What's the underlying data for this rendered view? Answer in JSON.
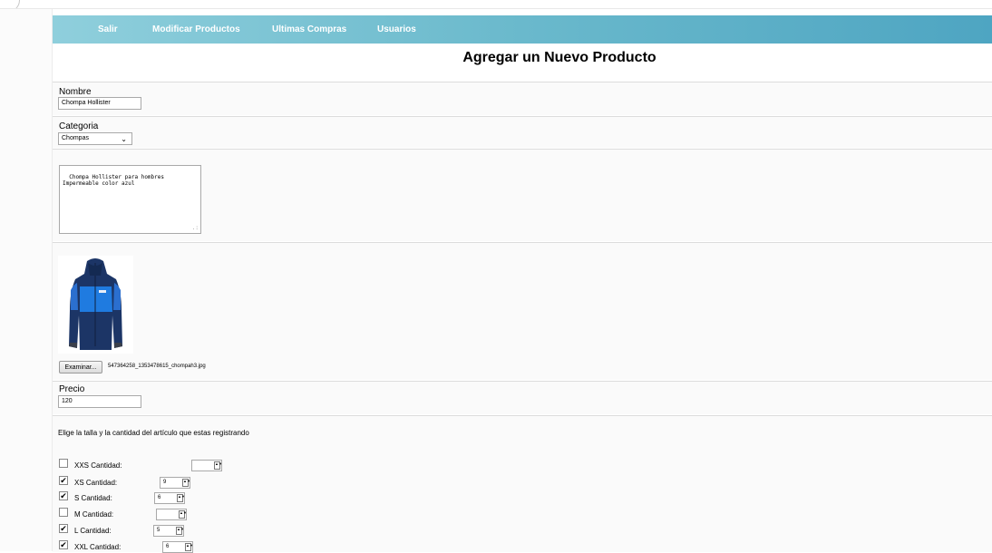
{
  "nav": {
    "items": [
      {
        "label": "Salir"
      },
      {
        "label": "Modificar Productos"
      },
      {
        "label": "Ultimas Compras"
      },
      {
        "label": "Usuarios"
      }
    ]
  },
  "page_title": "Agregar un Nuevo Producto",
  "form": {
    "nombre": {
      "label": "Nombre",
      "value": "Chompa Hollister"
    },
    "categoria": {
      "label": "Categoria",
      "value": "Chompas"
    },
    "descripcion": {
      "value": "Chompa Hollister para hombres\nImpermeable color azul"
    },
    "imagen": {
      "button_label": "Examinar...",
      "file_name": "547364258_1353478615_chompah3.jpg",
      "alt": "jacket-photo"
    },
    "precio": {
      "label": "Precio",
      "value": "120"
    },
    "tallas_instruction": "Elige la talla y la cantidad del artículo que estas registrando",
    "tallas": [
      {
        "label": "XXS Cantidad:",
        "checked": false,
        "qty": ""
      },
      {
        "label": "XS Cantidad:",
        "checked": true,
        "qty": "9"
      },
      {
        "label": "S Cantidad:",
        "checked": true,
        "qty": "6"
      },
      {
        "label": "M Cantidad:",
        "checked": false,
        "qty": ""
      },
      {
        "label": "L Cantidad:",
        "checked": true,
        "qty": "5"
      },
      {
        "label": "XXL Cantidad:",
        "checked": true,
        "qty": "6"
      }
    ]
  },
  "colors": {
    "nav_start": "#8fcfdc",
    "nav_end": "#4ea5c2",
    "jacket_primary": "#1f7be0",
    "jacket_dark": "#1c3566"
  }
}
